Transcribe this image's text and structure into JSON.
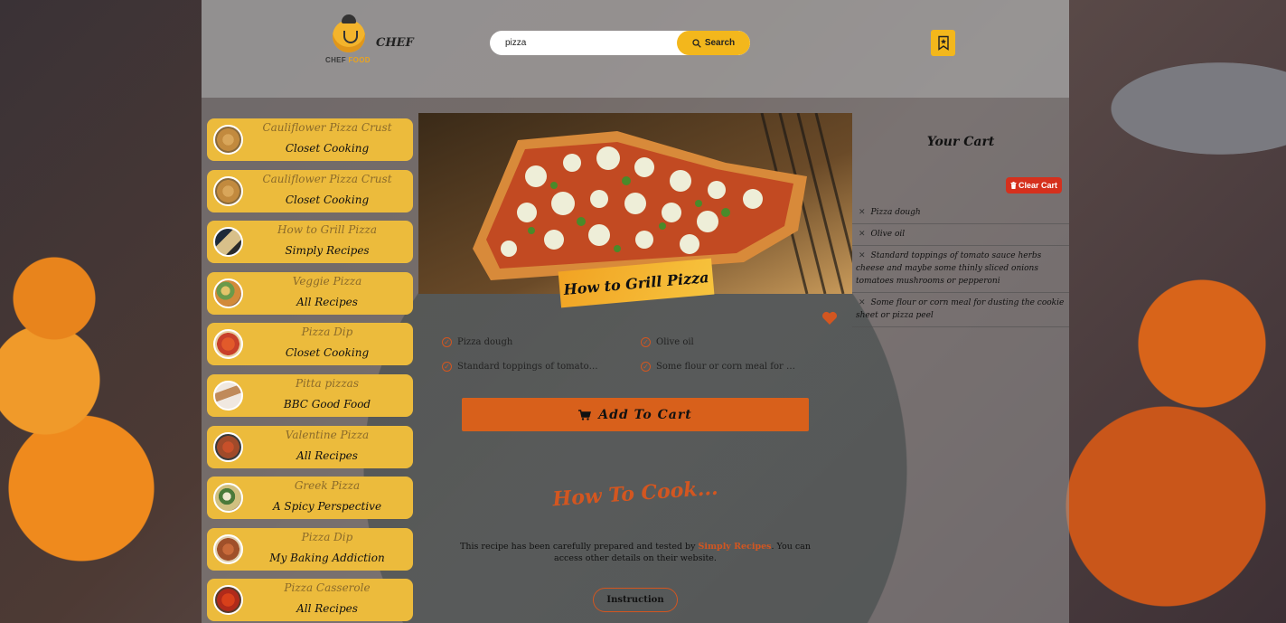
{
  "header": {
    "logo_title": "CHEF",
    "logo_sub_a": "CHEF ",
    "logo_sub_b": "FOOD",
    "search_value": "pizza",
    "search_button": "Search"
  },
  "sidebar": {
    "items": [
      {
        "title": "Cauliflower Pizza Crust",
        "publisher": "Closet Cooking",
        "thumb": "cauliflower"
      },
      {
        "title": "Cauliflower Pizza Crust",
        "publisher": "Closet Cooking",
        "thumb": "cauliflower"
      },
      {
        "title": "How to Grill Pizza",
        "publisher": "Simply Recipes",
        "thumb": "grill"
      },
      {
        "title": "Veggie Pizza",
        "publisher": "All Recipes",
        "thumb": "veggie"
      },
      {
        "title": "Pizza Dip",
        "publisher": "Closet Cooking",
        "thumb": "dip"
      },
      {
        "title": "Pitta pizzas",
        "publisher": "BBC Good Food",
        "thumb": "pitta"
      },
      {
        "title": "Valentine Pizza",
        "publisher": "All Recipes",
        "thumb": "valentine"
      },
      {
        "title": "Greek Pizza",
        "publisher": "A Spicy Perspective",
        "thumb": "greek"
      },
      {
        "title": "Pizza Dip",
        "publisher": "My Baking Addiction",
        "thumb": "dip2"
      },
      {
        "title": "Pizza Casserole",
        "publisher": "All Recipes",
        "thumb": "casserole"
      }
    ]
  },
  "recipe": {
    "title": "How to Grill Pizza",
    "ingredients": [
      "Pizza dough",
      "Olive oil",
      "Standard toppings of tomato…",
      "Some flour or corn meal for …"
    ],
    "add_to_cart": "Add To Cart",
    "how_to_cook": "How To Cook...",
    "cook_text_a": "This recipe has been carefully prepared and tested by ",
    "cook_publisher": "Simply Recipes",
    "cook_text_b": ". You can access other details on their website.",
    "instruction_button": "Instruction"
  },
  "cart": {
    "title": "Your Cart",
    "clear_button": "Clear Cart",
    "items": [
      "Pizza dough",
      "Olive oil",
      "Standard toppings of tomato sauce herbs cheese and maybe some thinly sliced onions tomatoes mushrooms or pepperoni",
      "Some flour or corn meal for dusting the cookie sheet or pizza peel"
    ]
  },
  "colors": {
    "accent_yellow": "#f3b71c",
    "accent_orange": "#d8601b",
    "danger_red": "#d5301d"
  }
}
